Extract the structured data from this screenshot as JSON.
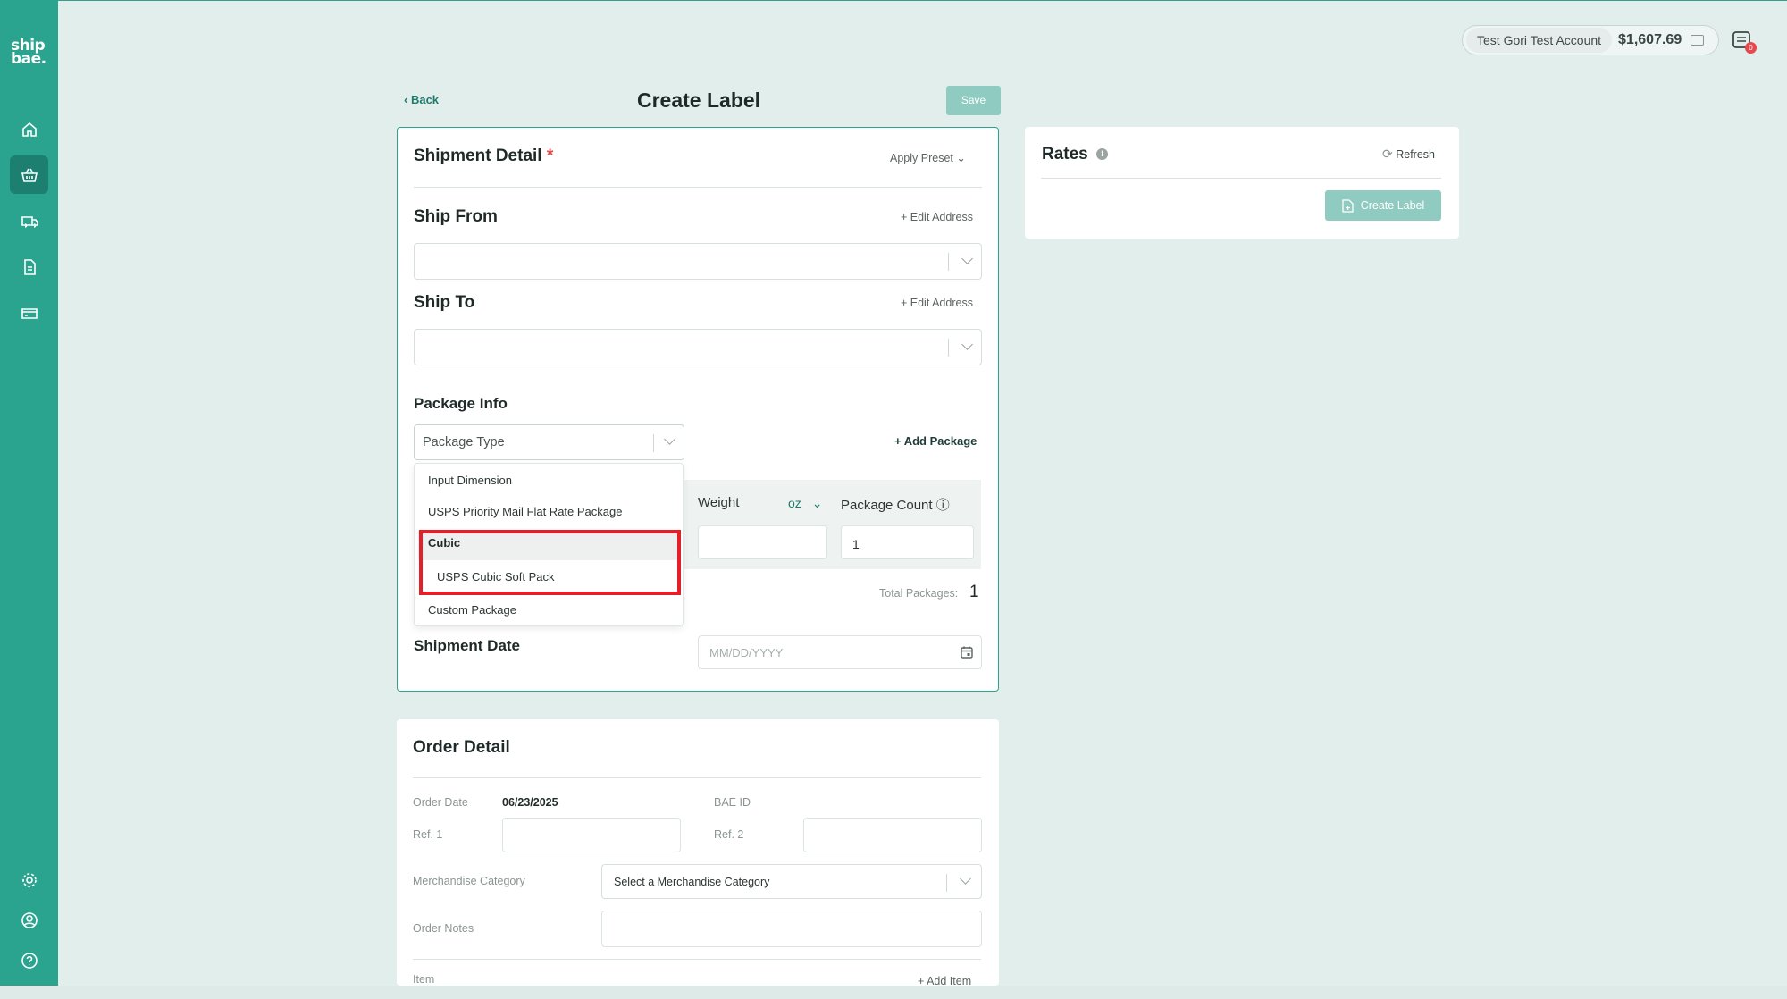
{
  "app": {
    "logo_line1": "ship",
    "logo_line2": "bae."
  },
  "header": {
    "account_name": "Test Gori Test Account",
    "balance": "$1,607.69",
    "notification_count": "0"
  },
  "page": {
    "back_label": "Back",
    "title": "Create Label",
    "save_label": "Save"
  },
  "shipment": {
    "title": "Shipment Detail",
    "required_mark": "*",
    "apply_preset": "Apply Preset",
    "ship_from": "Ship From",
    "ship_to": "Ship To",
    "edit_address": "+ Edit Address",
    "package_info": "Package Info",
    "package_type_placeholder": "Package Type",
    "add_package": "+ Add Package",
    "weight_label": "Weight",
    "weight_unit": "oz",
    "package_count_label": "Package Count",
    "package_count_value": "1",
    "total_packages_label": "Total Packages:",
    "total_packages_value": "1",
    "shipment_date": "Shipment Date",
    "date_placeholder": "MM/DD/YYYY"
  },
  "dropdown": {
    "items": [
      "Input Dimension",
      "USPS Priority Mail Flat Rate Package"
    ],
    "group_label": "Cubic",
    "group_items": [
      "USPS Cubic Soft Pack"
    ],
    "trailing_item": "Custom Package"
  },
  "order": {
    "title": "Order Detail",
    "order_date_label": "Order Date",
    "order_date_value": "06/23/2025",
    "bae_id_label": "BAE ID",
    "ref1_label": "Ref. 1",
    "ref2_label": "Ref. 2",
    "merch_label": "Merchandise Category",
    "merch_placeholder": "Select a Merchandise Category",
    "notes_label": "Order Notes",
    "item_label": "Item",
    "add_item": "+ Add Item"
  },
  "rates": {
    "title": "Rates",
    "refresh": "Refresh",
    "create_label": "Create Label"
  },
  "colors": {
    "brand": "#2aa38f",
    "highlight": "#e3202a",
    "background": "#e2eeec"
  }
}
